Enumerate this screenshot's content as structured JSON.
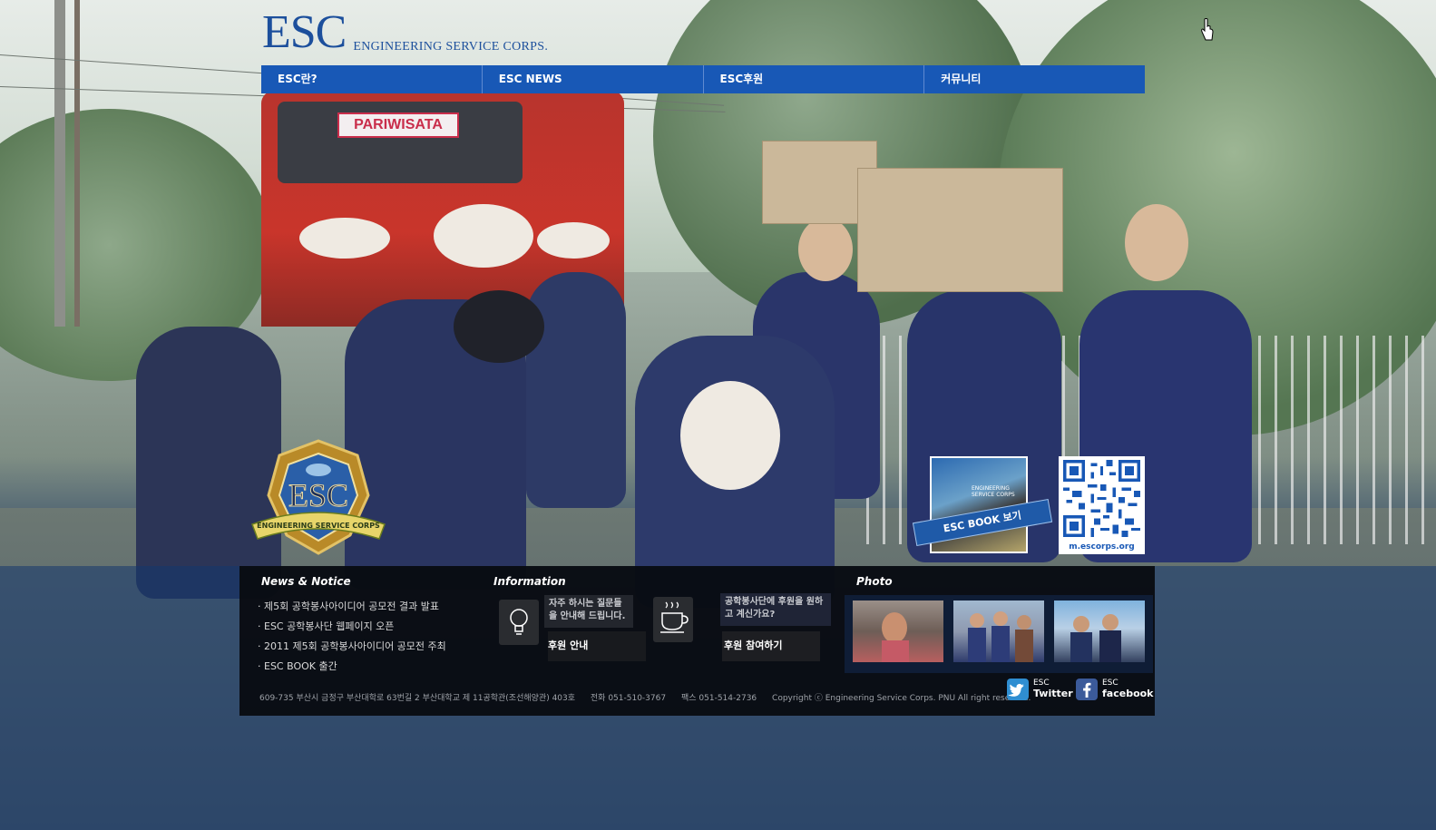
{
  "logo": {
    "main": "ESC",
    "sub": "ENGINEERING SERVICE CORPS."
  },
  "nav": {
    "items": [
      "ESC란?",
      "ESC NEWS",
      "ESC후원",
      "커뮤니티"
    ]
  },
  "background": {
    "bus_sign": "PARIWISATA"
  },
  "emblem": {
    "text": "ESC",
    "ribbon": "ENGINEERING SERVICE CORPS"
  },
  "book": {
    "label": "ESC BOOK 보기",
    "cover_title": "ENGINEERING SERVICE CORPS"
  },
  "qr": {
    "label": "m.escorps.org"
  },
  "news": {
    "title": "News & Notice",
    "items": [
      "제5회 공학봉사아이디어 공모전 결과 발표",
      "ESC 공학봉사단 웹페이지 오픈",
      "2011 제5회 공학봉사아이디어 공모전 주최",
      "ESC BOOK 출간"
    ]
  },
  "information": {
    "title": "Information",
    "faq_text": "자주 하시는 질문들을 안내해 드립니다.",
    "faq_link": "후원 안내",
    "support_text": "공학봉사단에 후원을 원하고 계신가요?",
    "support_link": "후원 참여하기"
  },
  "photo": {
    "title": "Photo"
  },
  "footer": {
    "address": "609-735  부산시 금정구  부산대학로 63번길 2 부산대학교 제 11공학관(조선해양관) 403호",
    "phone": "전화 051-510-3767",
    "fax": "팩스 051-514-2736",
    "copyright": "Copyright ⓒ Engineering Service Corps. PNU All right reserved."
  },
  "sns": {
    "twitter": {
      "top": "ESC",
      "bottom": "Twitter"
    },
    "facebook": {
      "top": "ESC",
      "bottom": "facebook"
    }
  },
  "colors": {
    "nav_blue": "#1858b6",
    "logo_blue": "#1c4f9c",
    "panel_black": "#08090e"
  }
}
